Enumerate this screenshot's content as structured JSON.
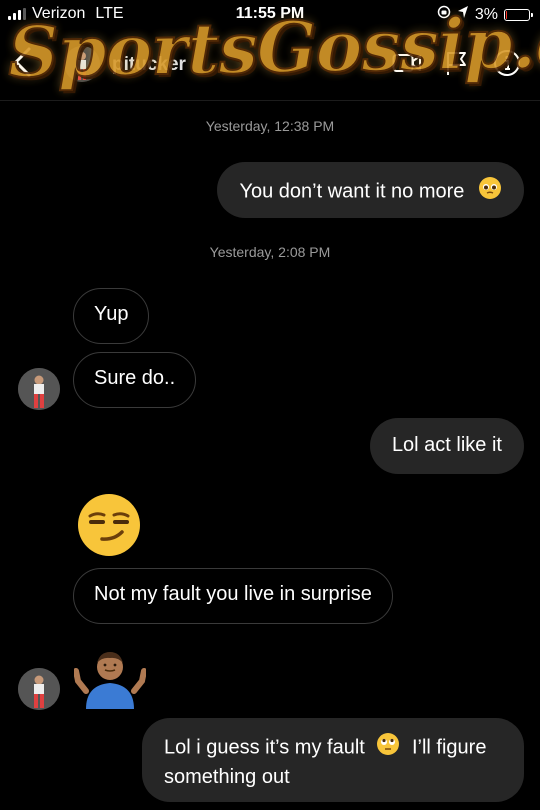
{
  "status_bar": {
    "carrier": "Verizon",
    "network": "LTE",
    "time": "11:55 PM",
    "battery": "3%",
    "battery_level": 0.03
  },
  "header": {
    "username": "pitucker"
  },
  "watermark": {
    "text": "SportsGossip.com"
  },
  "thread": {
    "timestamps": [
      "Yesterday, 12:38 PM",
      "Yesterday, 2:08 PM"
    ],
    "messages": [
      {
        "sender": "me",
        "text": "You don’t want it no more",
        "emoji": "pleading-face"
      },
      {
        "sender": "them",
        "text": "Yup"
      },
      {
        "sender": "them",
        "text": "Sure do.."
      },
      {
        "sender": "me",
        "text": "Lol act like it"
      },
      {
        "sender": "them",
        "type": "emoji",
        "emoji": "smirking-face"
      },
      {
        "sender": "them",
        "text": "Not my fault you live in surprise"
      },
      {
        "sender": "them",
        "type": "emoji",
        "emoji": "person-shrugging"
      },
      {
        "sender": "me",
        "text_line1": "Lol i guess it’s my fault",
        "text_line2": "I’ll figure",
        "text_line3": "something out",
        "emoji": "face-with-rolling-eyes"
      }
    ]
  },
  "colors": {
    "outgoing_bubble": "#262626",
    "incoming_border": "#3a3a3a",
    "battery_low": "#ff3b30",
    "watermark": "#d89a2a"
  }
}
